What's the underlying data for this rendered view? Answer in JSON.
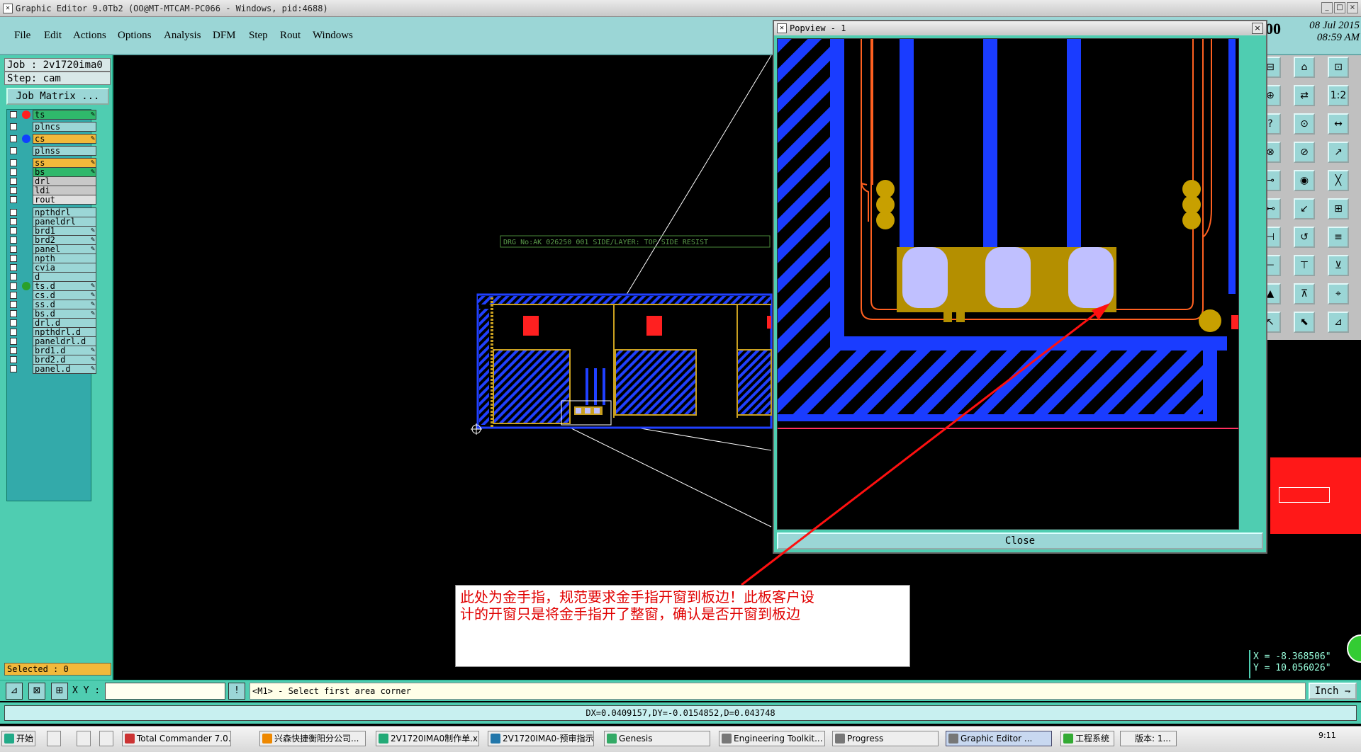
{
  "window": {
    "title": "Graphic Editor 9.0Tb2 (OO@MT-MTCAM-PC066 - Windows, pid:4688)",
    "controls": [
      "_",
      "□",
      "×"
    ]
  },
  "menu": [
    "File",
    "Edit",
    "Actions",
    "Options",
    "Analysis",
    "DFM",
    "Step",
    "Rout",
    "Windows"
  ],
  "clock_header": {
    "big": "00",
    "date": "08 Jul 2015",
    "time": "08:59 AM"
  },
  "job": {
    "job_line": "Job : 2v1720ima0",
    "step_line": "Step: cam",
    "matrix_button": "Job Matrix ..."
  },
  "layers": [
    {
      "name": "ts",
      "fill": "#2fb86b",
      "dot": "#ff2020",
      "editable": true
    },
    {
      "name": "plncs",
      "fill": "#9bd6d6",
      "dot": "",
      "editable": false
    },
    {
      "name": "cs",
      "fill": "#f2b93b",
      "dot": "#1040ff",
      "editable": true
    },
    {
      "name": "plnss",
      "fill": "#9bd6d6",
      "dot": "",
      "editable": false
    },
    {
      "name": "ss",
      "fill": "#f2b93b",
      "dot": "",
      "editable": true
    },
    {
      "name": "bs",
      "fill": "#2fb86b",
      "dot": "",
      "editable": true
    },
    {
      "name": "drl",
      "fill": "#c8c8c8",
      "dot": "",
      "editable": false
    },
    {
      "name": "ldi",
      "fill": "#c8c8c8",
      "dot": "",
      "editable": false
    },
    {
      "name": "rout",
      "fill": "#e0e0e0",
      "dot": "",
      "editable": false
    },
    {
      "name": "npthdrl",
      "fill": "#9bd6d6",
      "dot": "",
      "editable": false
    },
    {
      "name": "paneldrl",
      "fill": "#9bd6d6",
      "dot": "",
      "editable": false
    },
    {
      "name": "brd1",
      "fill": "#9bd6d6",
      "dot": "",
      "editable": true
    },
    {
      "name": "brd2",
      "fill": "#9bd6d6",
      "dot": "",
      "editable": true
    },
    {
      "name": "panel",
      "fill": "#9bd6d6",
      "dot": "",
      "editable": true
    },
    {
      "name": "npth",
      "fill": "#9bd6d6",
      "dot": "",
      "editable": false
    },
    {
      "name": "cvia",
      "fill": "#9bd6d6",
      "dot": "",
      "editable": false
    },
    {
      "name": "d",
      "fill": "#9bd6d6",
      "dot": "",
      "editable": false
    },
    {
      "name": "ts.d",
      "fill": "#9bd6d6",
      "dot": "#2aa02a",
      "editable": true
    },
    {
      "name": "cs.d",
      "fill": "#9bd6d6",
      "dot": "",
      "editable": true
    },
    {
      "name": "ss.d",
      "fill": "#9bd6d6",
      "dot": "",
      "editable": true
    },
    {
      "name": "bs.d",
      "fill": "#9bd6d6",
      "dot": "",
      "editable": true
    },
    {
      "name": "drl.d",
      "fill": "#9bd6d6",
      "dot": "",
      "editable": false
    },
    {
      "name": "npthdrl.d",
      "fill": "#9bd6d6",
      "dot": "",
      "editable": false
    },
    {
      "name": "paneldrl.d",
      "fill": "#9bd6d6",
      "dot": "",
      "editable": false
    },
    {
      "name": "brd1.d",
      "fill": "#9bd6d6",
      "dot": "",
      "editable": true
    },
    {
      "name": "brd2.d",
      "fill": "#9bd6d6",
      "dot": "",
      "editable": true
    },
    {
      "name": "panel.d",
      "fill": "#9bd6d6",
      "dot": "",
      "editable": true
    }
  ],
  "selected_label": "Selected : 0",
  "canvas": {
    "drg_label": "DRG No:AK 026250 001  SIDE/LAYER: TOP SIDE RESIST"
  },
  "popview": {
    "title": "Popview - 1",
    "close_x": "×",
    "close_button": "Close"
  },
  "annotation": {
    "line1": "此处为金手指，规范要求金手指开窗到板边！此板客户设",
    "line2": "计的开窗只是将金手指开了整窗，确认是否开窗到板边"
  },
  "coords": {
    "x": "X = -8.368506\"",
    "y": "Y = 10.056026\""
  },
  "command": {
    "xy_label": "X Y :",
    "xy_value": "",
    "message": "<M1> - Select first area corner",
    "unit": "Inch ⇁"
  },
  "status": "DX=0.0409157,DY=-0.0154852,D=0.043748",
  "taskbar": {
    "start": "开始",
    "items": [
      {
        "label": "Total Commander 7.0...",
        "color": "#c33"
      },
      {
        "label": "兴森快捷衡阳分公司...",
        "color": "#e80"
      },
      {
        "label": "2V1720IMA0制作单.xls",
        "color": "#2a7"
      },
      {
        "label": "2V1720IMA0-预审指示...",
        "color": "#27a"
      },
      {
        "label": "Genesis",
        "color": "#3a6"
      },
      {
        "label": "Engineering Toolkit...",
        "color": "#777"
      },
      {
        "label": "Progress",
        "color": "#777"
      },
      {
        "label": "Graphic Editor ...",
        "color": "#777"
      },
      {
        "label": "工程系统",
        "color": "#3a3"
      },
      {
        "label": "版本: 1...",
        "color": ""
      }
    ],
    "clock": "9:11"
  }
}
